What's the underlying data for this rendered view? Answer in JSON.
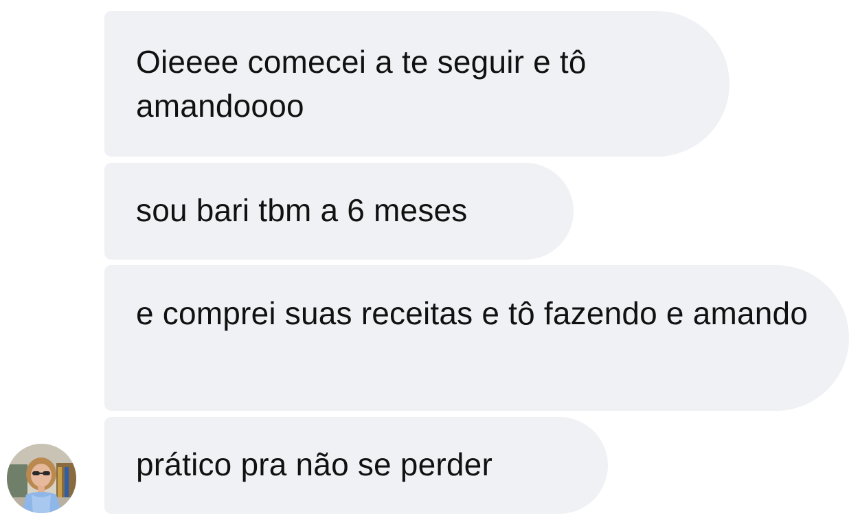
{
  "messages": [
    {
      "text": "Oieeee comecei a te seguir e tô amandoooo"
    },
    {
      "text": "sou bari tbm a 6 meses"
    },
    {
      "text": "e comprei suas receitas e tô fazendo e amando"
    },
    {
      "text": "prático pra não se perder"
    }
  ],
  "sender": {
    "avatar_icon": "profile-photo-icon"
  },
  "colors": {
    "bubble_background": "#f0f1f4",
    "text": "#111111",
    "page_background": "#ffffff"
  }
}
